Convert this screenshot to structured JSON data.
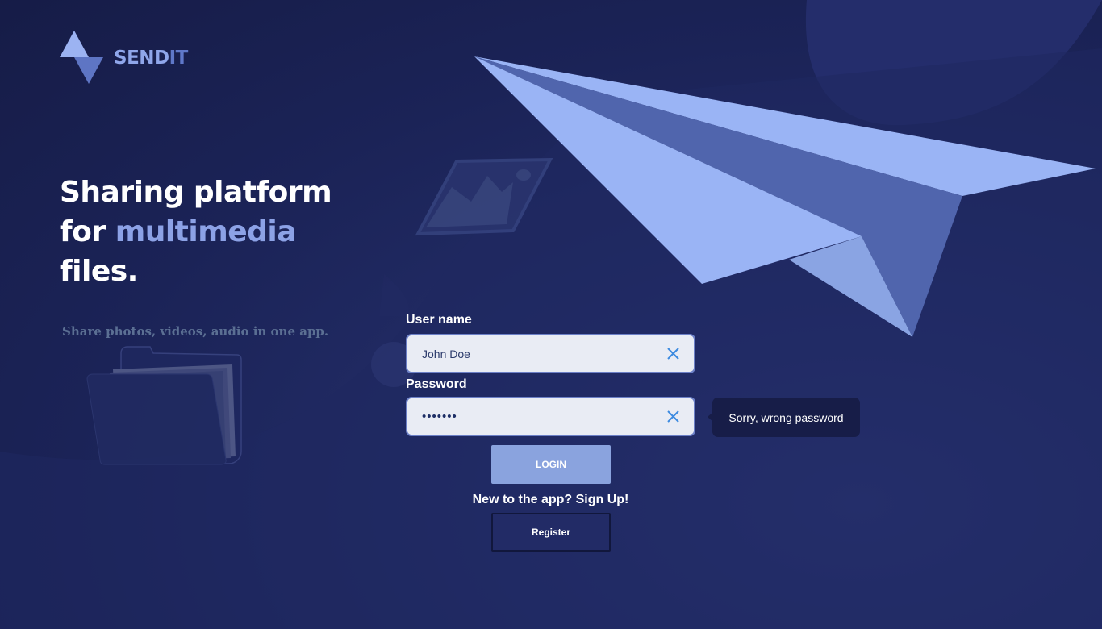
{
  "brand": {
    "name_part1": "SEND",
    "name_part2": "IT"
  },
  "hero": {
    "line1": "Sharing platform",
    "line2_prefix": "for ",
    "line2_accent": "multimedia",
    "line3": "files.",
    "subtitle": "Share photos, videos, audio in one app."
  },
  "login_form": {
    "username_label": "User name",
    "username_value": "John Doe",
    "password_label": "Password",
    "password_value": "1234567",
    "error_tooltip": "Sorry, wrong password",
    "login_button": "LOGIN",
    "signup_prompt": "New to the app? Sign Up!",
    "register_button": "Register"
  },
  "icons": {
    "logo": "sendit-triangle-logo-icon",
    "clear": "close-icon",
    "illustration_plane": "paper-plane-illustration",
    "illustration_image": "picture-frame-icon",
    "illustration_folder": "folder-icon"
  },
  "colors": {
    "background": "#1b2357",
    "accent": "#8ca2e6",
    "plane_light": "#9ab4f5",
    "plane_dark": "#5065ad",
    "field_bg": "#e9ecf4",
    "field_border": "#6b7fc6",
    "clear_icon": "#3d8be0",
    "login_button": "#8aa3de",
    "register_button": "#222b66",
    "tooltip_bg": "#171d48",
    "subtitle": "#5b6f93"
  }
}
